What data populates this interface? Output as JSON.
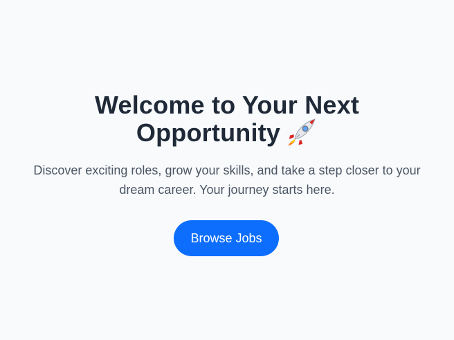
{
  "hero": {
    "title_line1": "Welcome to Your Next",
    "title_line2": "Opportunity",
    "title_icon": "rocket-icon",
    "subtitle_line1": "Discover exciting roles, grow your skills, and take a step closer to your",
    "subtitle_line2": "dream career. Your journey starts here.",
    "button_label": "Browse Jobs"
  },
  "colors": {
    "background": "#f8fafc",
    "title": "#1f2937",
    "subtitle": "#4b5563",
    "button": "#0d6efd",
    "button_text": "#ffffff"
  }
}
